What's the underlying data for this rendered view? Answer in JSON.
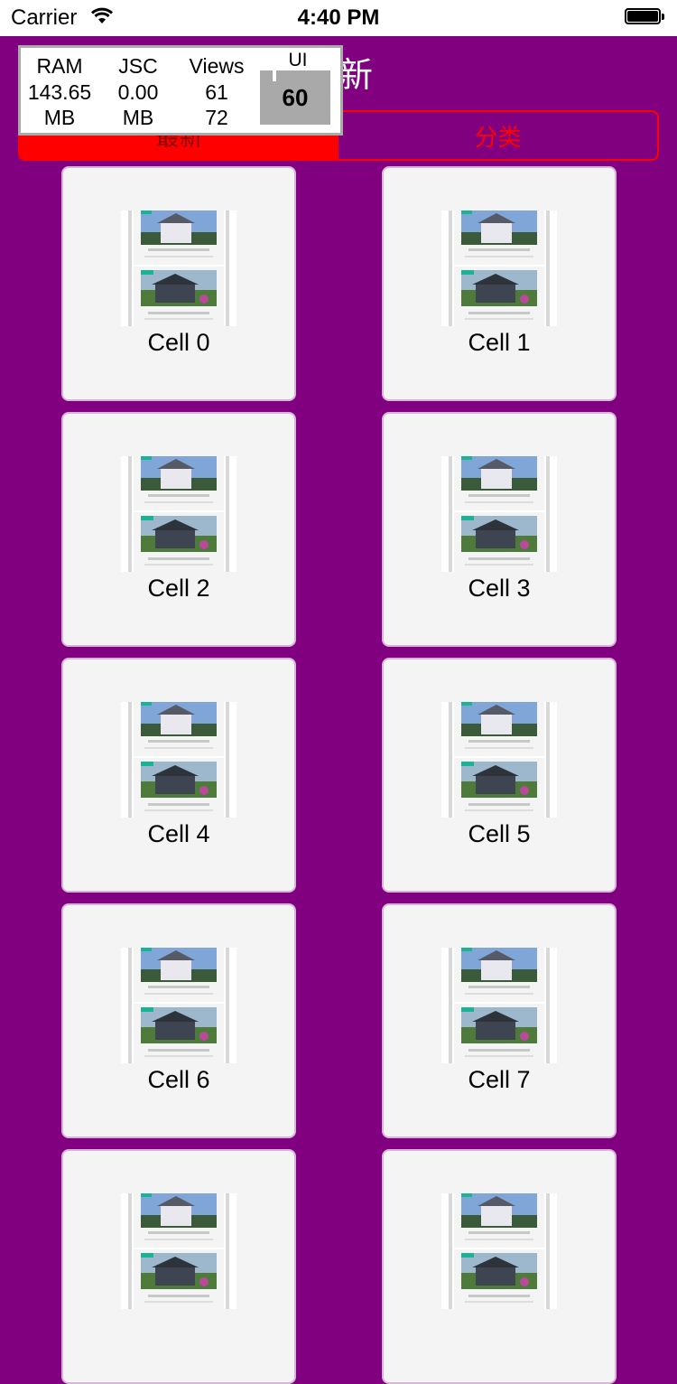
{
  "status_bar": {
    "carrier": "Carrier",
    "time": "4:40 PM"
  },
  "nav": {
    "title": "最新"
  },
  "segmented": {
    "items": [
      "最新",
      "分类"
    ],
    "selected_index": 0,
    "accent": "#ff0000"
  },
  "perf_monitor": {
    "ram": {
      "label": "RAM",
      "value": "143.65",
      "unit": "MB"
    },
    "jsc": {
      "label": "JSC",
      "value": "0.00",
      "unit": "MB"
    },
    "views": {
      "label": "Views",
      "value": "61",
      "value2": "72"
    },
    "ui": {
      "label": "UI",
      "fps": "60"
    }
  },
  "grid": {
    "background": "#800080",
    "cells": [
      {
        "label": "Cell 0"
      },
      {
        "label": "Cell 1"
      },
      {
        "label": "Cell 2"
      },
      {
        "label": "Cell 3"
      },
      {
        "label": "Cell 4"
      },
      {
        "label": "Cell 5"
      },
      {
        "label": "Cell 6"
      },
      {
        "label": "Cell 7"
      },
      {
        "label": ""
      },
      {
        "label": ""
      }
    ]
  }
}
